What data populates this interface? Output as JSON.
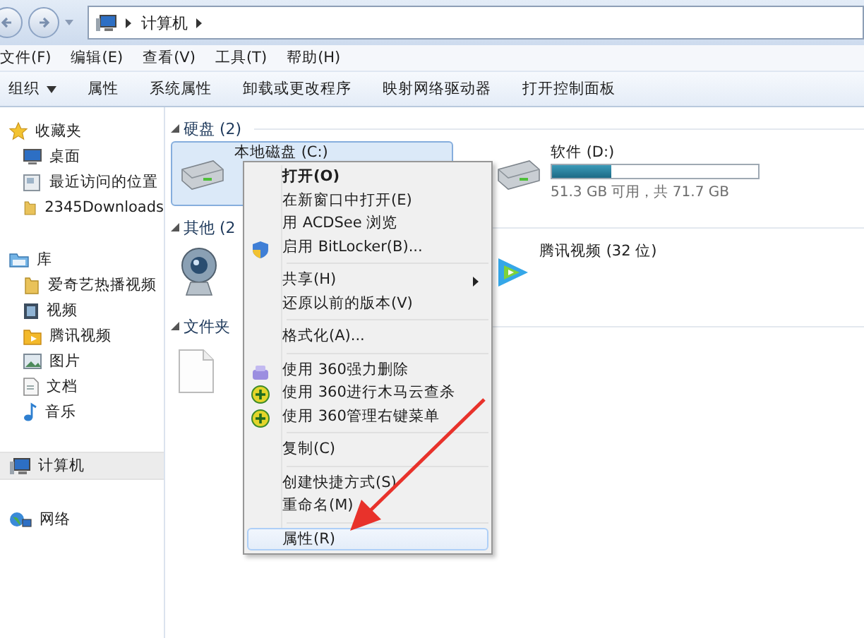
{
  "address_bar": {
    "crumbs": [
      {
        "label": "计算机"
      }
    ]
  },
  "menu_bar": {
    "items": [
      {
        "label": "文件(F)"
      },
      {
        "label": "编辑(E)"
      },
      {
        "label": "查看(V)"
      },
      {
        "label": "工具(T)"
      },
      {
        "label": "帮助(H)"
      }
    ]
  },
  "toolbar": {
    "items": [
      {
        "label": "组织",
        "dropdown": true
      },
      {
        "label": "属性",
        "dropdown": false
      },
      {
        "label": "系统属性",
        "dropdown": false
      },
      {
        "label": "卸载或更改程序",
        "dropdown": false
      },
      {
        "label": "映射网络驱动器",
        "dropdown": false
      },
      {
        "label": "打开控制面板",
        "dropdown": false
      }
    ]
  },
  "sidebar": {
    "items": [
      {
        "label": "收藏夹",
        "selected": false,
        "children": [
          {
            "label": "桌面",
            "selected": false
          },
          {
            "label": "最近访问的位置",
            "selected": false
          },
          {
            "label": "2345Downloads",
            "selected": false
          }
        ]
      },
      {
        "label": "库",
        "selected": false,
        "children": [
          {
            "label": "爱奇艺热播视频",
            "selected": false
          },
          {
            "label": "视频",
            "selected": false
          },
          {
            "label": "腾讯视频",
            "selected": false
          },
          {
            "label": "图片",
            "selected": false
          },
          {
            "label": "文档",
            "selected": false
          },
          {
            "label": "音乐",
            "selected": false
          }
        ]
      },
      {
        "label": "计算机",
        "selected": true
      },
      {
        "label": "网络",
        "selected": false
      }
    ]
  },
  "groups": [
    {
      "title": "硬盘 (2)",
      "items": [
        {
          "kind": "drive",
          "name": "本地磁盘 (C:)",
          "selected": true
        },
        {
          "kind": "drive",
          "name": "软件 (D:)",
          "selected": false,
          "level": 0.29,
          "detail": "51.3 GB 可用，共 71.7 GB"
        }
      ]
    },
    {
      "title": "其他 (2",
      "items": [
        {
          "kind": "webcam",
          "selected": false
        },
        {
          "kind": "app",
          "name": "腾讯视频 (32 位)",
          "selected": false
        }
      ]
    },
    {
      "title": "文件夹",
      "items": [
        {
          "kind": "file",
          "selected": false
        }
      ]
    }
  ],
  "context_menu": {
    "items": [
      {
        "kind": "item",
        "label": "打开(O)",
        "bold": true,
        "submenu": false,
        "selected": false
      },
      {
        "kind": "item",
        "label": "在新窗口中打开(E)",
        "bold": false,
        "submenu": false,
        "selected": false
      },
      {
        "kind": "item",
        "label": "用 ACDSee 浏览",
        "bold": false,
        "submenu": false,
        "selected": false
      },
      {
        "kind": "item",
        "label": "启用 BitLocker(B)...",
        "bold": false,
        "submenu": false,
        "selected": false
      },
      {
        "kind": "separator"
      },
      {
        "kind": "item",
        "label": "共享(H)",
        "bold": false,
        "submenu": true,
        "selected": false
      },
      {
        "kind": "item",
        "label": "还原以前的版本(V)",
        "bold": false,
        "submenu": false,
        "selected": false
      },
      {
        "kind": "separator"
      },
      {
        "kind": "item",
        "label": "格式化(A)...",
        "bold": false,
        "submenu": false,
        "selected": false
      },
      {
        "kind": "separator"
      },
      {
        "kind": "item",
        "label": "使用 360强力删除",
        "bold": false,
        "submenu": false,
        "selected": false
      },
      {
        "kind": "item",
        "label": "使用 360进行木马云查杀",
        "bold": false,
        "submenu": false,
        "selected": false
      },
      {
        "kind": "item",
        "label": "使用 360管理右键菜单",
        "bold": false,
        "submenu": false,
        "selected": false
      },
      {
        "kind": "separator"
      },
      {
        "kind": "item",
        "label": "复制(C)",
        "bold": false,
        "submenu": false,
        "selected": false
      },
      {
        "kind": "separator"
      },
      {
        "kind": "item",
        "label": "创建快捷方式(S)",
        "bold": false,
        "submenu": false,
        "selected": false
      },
      {
        "kind": "item",
        "label": "重命名(M)",
        "bold": false,
        "submenu": false,
        "selected": false
      },
      {
        "kind": "separator"
      },
      {
        "kind": "item",
        "label": "属性(R)",
        "bold": false,
        "submenu": false,
        "selected": true
      }
    ]
  }
}
